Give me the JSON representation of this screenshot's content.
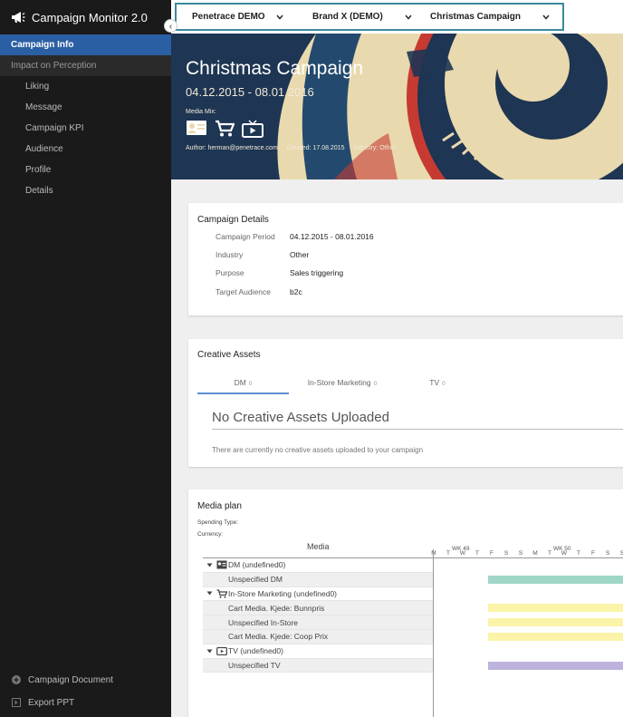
{
  "app": {
    "title": "Campaign Monitor 2.0"
  },
  "sidebar": {
    "active_item": "Campaign Info",
    "section": "Impact on Perception",
    "sub_items": [
      "Liking",
      "Message",
      "Campaign KPI",
      "Audience",
      "Profile",
      "Details"
    ],
    "bottom_items": [
      {
        "label": "Campaign Document",
        "icon": "plus-circle-icon"
      },
      {
        "label": "Export PPT",
        "icon": "export-icon"
      }
    ]
  },
  "topbar": {
    "selectors": [
      {
        "label": "Penetrace DEMO"
      },
      {
        "label": "Brand X (DEMO)"
      },
      {
        "label": "Christmas Campaign"
      }
    ]
  },
  "hero": {
    "title": "Christmas Campaign",
    "dates": "04.12.2015 - 08.01.2016",
    "media_mix_label": "Media Mix:",
    "media_icons": [
      "dm-icon",
      "cart-icon",
      "tv-icon"
    ],
    "author": "Author: herman@penetrace.com",
    "created": "Created: 17.08.2015",
    "industry": "Industry: Other"
  },
  "campaign_details": {
    "title": "Campaign Details",
    "rows": [
      {
        "label": "Campaign Period",
        "value": "04.12.2015 - 08.01.2016"
      },
      {
        "label": "Industry",
        "value": "Other"
      },
      {
        "label": "Purpose",
        "value": "Sales triggering"
      },
      {
        "label": "Target Audience",
        "value": "b2c"
      }
    ]
  },
  "creative_assets": {
    "title": "Creative Assets",
    "tabs": [
      {
        "label": "DM",
        "count": "0"
      },
      {
        "label": "In-Store Marketing",
        "count": "0"
      },
      {
        "label": "TV",
        "count": "0"
      }
    ],
    "empty_title": "No Creative Assets Uploaded",
    "empty_text": "There are currently no creative assets uploaded to your campaign"
  },
  "media_plan": {
    "title": "Media plan",
    "spending_type_label": "Spending Type:",
    "currency_label": "Currency:",
    "media_header": "Media",
    "weeks": [
      "WK 49",
      "WK 50"
    ],
    "days": [
      "M",
      "T",
      "W",
      "T",
      "F",
      "S",
      "S",
      "M",
      "T",
      "W",
      "T",
      "F",
      "S",
      "S"
    ],
    "rows": [
      {
        "label": "DM (undefined0)",
        "type": "group",
        "icon": "dm-icon"
      },
      {
        "label": "Unspecified DM",
        "type": "child",
        "color": "#9fd6c8"
      },
      {
        "label": "In-Store Marketing (undefined0)",
        "type": "group",
        "icon": "cart-icon"
      },
      {
        "label": "Cart Media. Kjede: Bunnpris",
        "type": "child",
        "color": "#fbf4a8"
      },
      {
        "label": "Unspecified In-Store",
        "type": "child",
        "color": "#fbf4a8"
      },
      {
        "label": "Cart Media. Kjede: Coop Prix",
        "type": "child",
        "color": "#fbf4a8"
      },
      {
        "label": "TV (undefined0)",
        "type": "group",
        "icon": "tv-icon"
      },
      {
        "label": "Unspecified TV",
        "type": "child",
        "color": "#bdb3dc"
      }
    ]
  },
  "colors": {
    "sidebar_bg": "#1a1a1a",
    "active_nav": "#2b5fa3",
    "selector_border": "#3a8a9c",
    "tab_active": "#5b8fd1"
  }
}
